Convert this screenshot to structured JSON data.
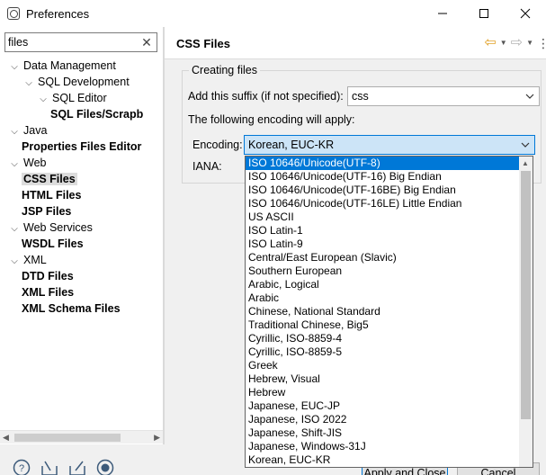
{
  "window": {
    "title": "Preferences"
  },
  "filter": {
    "value": "files",
    "clear_icon": "clear-icon"
  },
  "tree": [
    {
      "label": "Data Management",
      "expanded": true,
      "bold": false,
      "level": 0
    },
    {
      "label": "SQL Development",
      "expanded": true,
      "bold": false,
      "level": 1
    },
    {
      "label": "SQL Editor",
      "expanded": true,
      "bold": false,
      "level": 2
    },
    {
      "label": "SQL Files/Scrapb",
      "expanded": null,
      "bold": true,
      "level": 3
    },
    {
      "label": "Java",
      "expanded": true,
      "bold": false,
      "level": 0
    },
    {
      "label": "Properties Files Editor",
      "expanded": null,
      "bold": true,
      "level": 1
    },
    {
      "label": "Web",
      "expanded": true,
      "bold": false,
      "level": 0
    },
    {
      "label": "CSS Files",
      "expanded": null,
      "bold": true,
      "level": 1,
      "selected": true
    },
    {
      "label": "HTML Files",
      "expanded": null,
      "bold": true,
      "level": 1
    },
    {
      "label": "JSP Files",
      "expanded": null,
      "bold": true,
      "level": 1
    },
    {
      "label": "Web Services",
      "expanded": true,
      "bold": false,
      "level": 0
    },
    {
      "label": "WSDL Files",
      "expanded": null,
      "bold": true,
      "level": 1
    },
    {
      "label": "XML",
      "expanded": true,
      "bold": false,
      "level": 0
    },
    {
      "label": "DTD Files",
      "expanded": null,
      "bold": true,
      "level": 1
    },
    {
      "label": "XML Files",
      "expanded": null,
      "bold": true,
      "level": 1
    },
    {
      "label": "XML Schema Files",
      "expanded": null,
      "bold": true,
      "level": 1
    }
  ],
  "page": {
    "title": "CSS Files",
    "group_label": "Creating files",
    "suffix_label": "Add this suffix (if not specified):",
    "suffix_value": "css",
    "encoding_apply_label": "The following encoding will apply:",
    "encoding_label": "Encoding:",
    "encoding_value": "Korean, EUC-KR",
    "iana_label": "IANA:"
  },
  "encoding_options": [
    "ISO 10646/Unicode(UTF-8)",
    "ISO 10646/Unicode(UTF-16) Big Endian",
    "ISO 10646/Unicode(UTF-16BE) Big Endian",
    "ISO 10646/Unicode(UTF-16LE) Little Endian",
    "US ASCII",
    "ISO Latin-1",
    "ISO Latin-9",
    "Central/East European (Slavic)",
    "Southern European",
    "Arabic, Logical",
    "Arabic",
    "Chinese, National Standard",
    "Traditional Chinese, Big5",
    "Cyrillic, ISO-8859-4",
    "Cyrillic, ISO-8859-5",
    "Greek",
    "Hebrew, Visual",
    "Hebrew",
    "Japanese, EUC-JP",
    "Japanese, ISO 2022",
    "Japanese, Shift-JIS",
    "Japanese, Windows-31J",
    "Korean, EUC-KR"
  ],
  "highlighted_option_index": 0,
  "buttons": {
    "apply_close": "Apply and Close",
    "cancel": "Cancel"
  }
}
